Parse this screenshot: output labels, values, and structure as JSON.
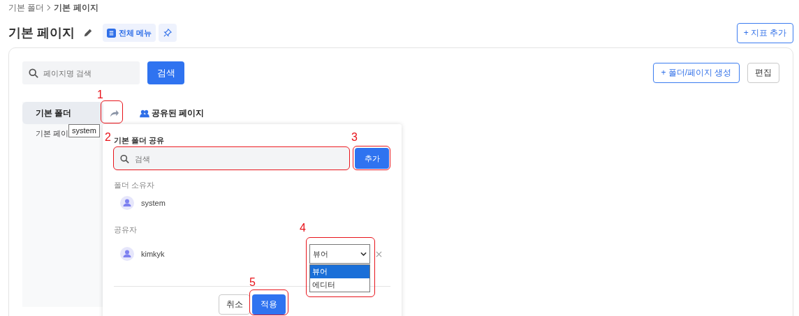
{
  "breadcrumb": {
    "parent": "기본 폴더",
    "current": "기본 페이지"
  },
  "page_title": "기본 페이지",
  "full_menu_button": "전체 메뉴",
  "add_indicator_button": "+ 지표 추가",
  "search": {
    "placeholder": "페이지명 검색"
  },
  "search_button": "검색",
  "create_button": "+ 폴더/페이지 생성",
  "edit_button": "편집",
  "folders": [
    {
      "label": "기본 폴더",
      "selected": true,
      "children": [
        {
          "label": "기본 페이"
        }
      ]
    }
  ],
  "shared_tab": "공유된 페이지",
  "tooltip": "system",
  "share_dialog": {
    "title": "기본 폴더 공유",
    "search": {
      "placeholder": "검색"
    },
    "add_button": "추가",
    "owner_label": "폴더 소유자",
    "owner": "system",
    "sharers_label": "공유자",
    "sharers": [
      {
        "name": "kimkyk",
        "role": "뷰어",
        "options": [
          {
            "label": "뷰어",
            "selected": true
          },
          {
            "label": "에디터",
            "selected": false
          }
        ]
      }
    ],
    "cancel_button": "취소",
    "apply_button": "적용"
  },
  "annotations": [
    {
      "label": "1"
    },
    {
      "label": "2"
    },
    {
      "label": "3"
    },
    {
      "label": "4"
    },
    {
      "label": "5"
    }
  ]
}
